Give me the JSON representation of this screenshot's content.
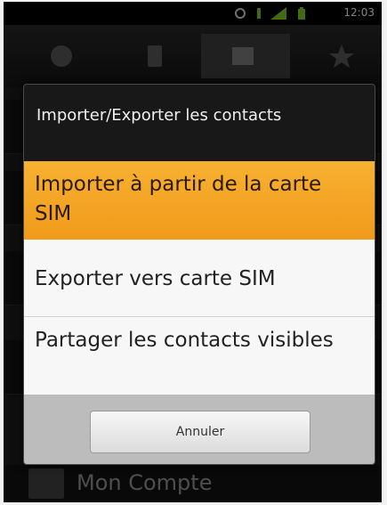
{
  "status_bar": {
    "time": "12:03",
    "icons": [
      "sync-icon",
      "usb-icon",
      "signal-icon",
      "battery-icon"
    ]
  },
  "tabs": [
    {
      "icon": "phone-icon",
      "selected": false
    },
    {
      "icon": "call-log-icon",
      "selected": false
    },
    {
      "icon": "contacts-icon",
      "selected": true
    },
    {
      "icon": "favorites-star-icon",
      "selected": false
    }
  ],
  "background_list": {
    "items": [
      "",
      "",
      "",
      "",
      "Mon Compte"
    ]
  },
  "dialog": {
    "title": "Importer/Exporter les contacts",
    "options": [
      {
        "label": "Importer à partir de la carte SIM",
        "selected": true
      },
      {
        "label": "Exporter vers carte SIM",
        "selected": false
      },
      {
        "label": "Partager les contacts visibles",
        "selected": false
      }
    ],
    "cancel_label": "Annuler"
  },
  "colors": {
    "highlight": "#f5a623",
    "dialog_bg": "#181818",
    "button_bar": "#bcbcbc"
  }
}
